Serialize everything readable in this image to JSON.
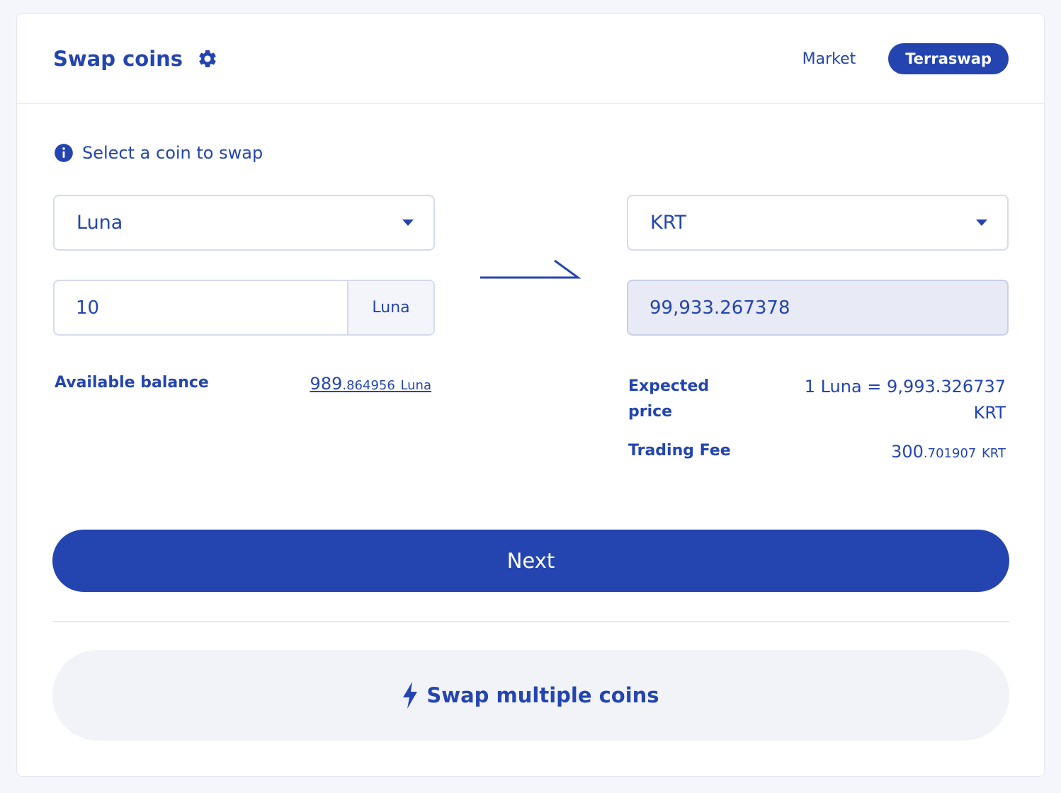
{
  "header": {
    "title": "Swap coins",
    "tabs": [
      {
        "label": "Market",
        "active": false
      },
      {
        "label": "Terraswap",
        "active": true
      }
    ]
  },
  "hint": "Select a coin to swap",
  "from": {
    "coin": "Luna",
    "amount": "10",
    "unit": "Luna"
  },
  "to": {
    "coin": "KRT",
    "amount": "99,933.267378"
  },
  "balance": {
    "label": "Available balance",
    "value_int": "989",
    "value_dec": ".864956",
    "unit": "Luna"
  },
  "expected": {
    "label": "Expected price",
    "value_line1": "1 Luna = 9,993.326737",
    "value_line2": "KRT"
  },
  "fee": {
    "label": "Trading Fee",
    "value_int": "300",
    "value_dec": ".701907",
    "unit": "KRT"
  },
  "next_label": "Next",
  "multi_label": "Swap multiple coins",
  "colors": {
    "primary": "#2445b0",
    "output_bg": "#e8eaf5",
    "secondary_bg": "#f1f3f9"
  },
  "icons": {
    "settings": "gear-icon",
    "info": "info-icon",
    "arrow": "arrow-right-icon",
    "caret": "chevron-down-icon",
    "bolt": "lightning-bolt-icon"
  }
}
